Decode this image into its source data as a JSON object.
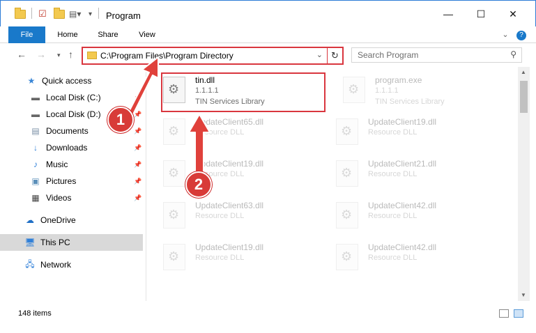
{
  "window": {
    "title": "Program",
    "minimize_glyph": "—",
    "maximize_glyph": "☐",
    "close_glyph": "✕"
  },
  "ribbon": {
    "tabs": [
      "File",
      "Home",
      "Share",
      "View"
    ],
    "expand_glyph": "⌄",
    "help_glyph": "?"
  },
  "address_bar": {
    "path": "C:\\Program Files\\Program Directory",
    "search_placeholder": "Search Program"
  },
  "nav_pane": {
    "items": [
      {
        "label": "Quick access",
        "icon": "star-icon"
      },
      {
        "label": "Local Disk (C:)",
        "icon": "drive-icon",
        "pinned": true
      },
      {
        "label": "Local Disk (D:)",
        "icon": "drive-icon",
        "pinned": true
      },
      {
        "label": "Documents",
        "icon": "documents-icon",
        "pinned": true
      },
      {
        "label": "Downloads",
        "icon": "downloads-icon",
        "pinned": true
      },
      {
        "label": "Music",
        "icon": "music-icon",
        "pinned": true
      },
      {
        "label": "Pictures",
        "icon": "pictures-icon",
        "pinned": true
      },
      {
        "label": "Videos",
        "icon": "videos-icon",
        "pinned": true
      },
      {
        "label": "OneDrive",
        "icon": "cloud-icon"
      },
      {
        "label": "This PC",
        "icon": "computer-icon",
        "selected": true
      },
      {
        "label": "Network",
        "icon": "network-icon"
      }
    ]
  },
  "files": [
    {
      "name": "tin.dll",
      "line1": "1.1.1.1",
      "line2": "TIN Services Library",
      "highlighted": true
    },
    {
      "name": "program.exe",
      "line1": "1.1.1.1",
      "line2": "TIN Services Library"
    },
    {
      "name": "UpdateClient65.dll",
      "line1": "Resource DLL",
      "line2": ""
    },
    {
      "name": "UpdateClient19.dll",
      "line1": "Resource DLL",
      "line2": ""
    },
    {
      "name": "UpdateClient19.dll",
      "line1": "Resource DLL",
      "line2": ""
    },
    {
      "name": "UpdateClient21.dll",
      "line1": "Resource DLL",
      "line2": ""
    },
    {
      "name": "UpdateClient63.dll",
      "line1": "Resource DLL",
      "line2": ""
    },
    {
      "name": "UpdateClient42.dll",
      "line1": "Resource DLL",
      "line2": ""
    },
    {
      "name": "UpdateClient19.dll",
      "line1": "Resource DLL",
      "line2": ""
    },
    {
      "name": "UpdateClient42.dll",
      "line1": "Resource DLL",
      "line2": ""
    }
  ],
  "status": {
    "item_count": "148 items"
  },
  "annotations": {
    "step1": "1",
    "step2": "2",
    "color": "#d9363e"
  }
}
